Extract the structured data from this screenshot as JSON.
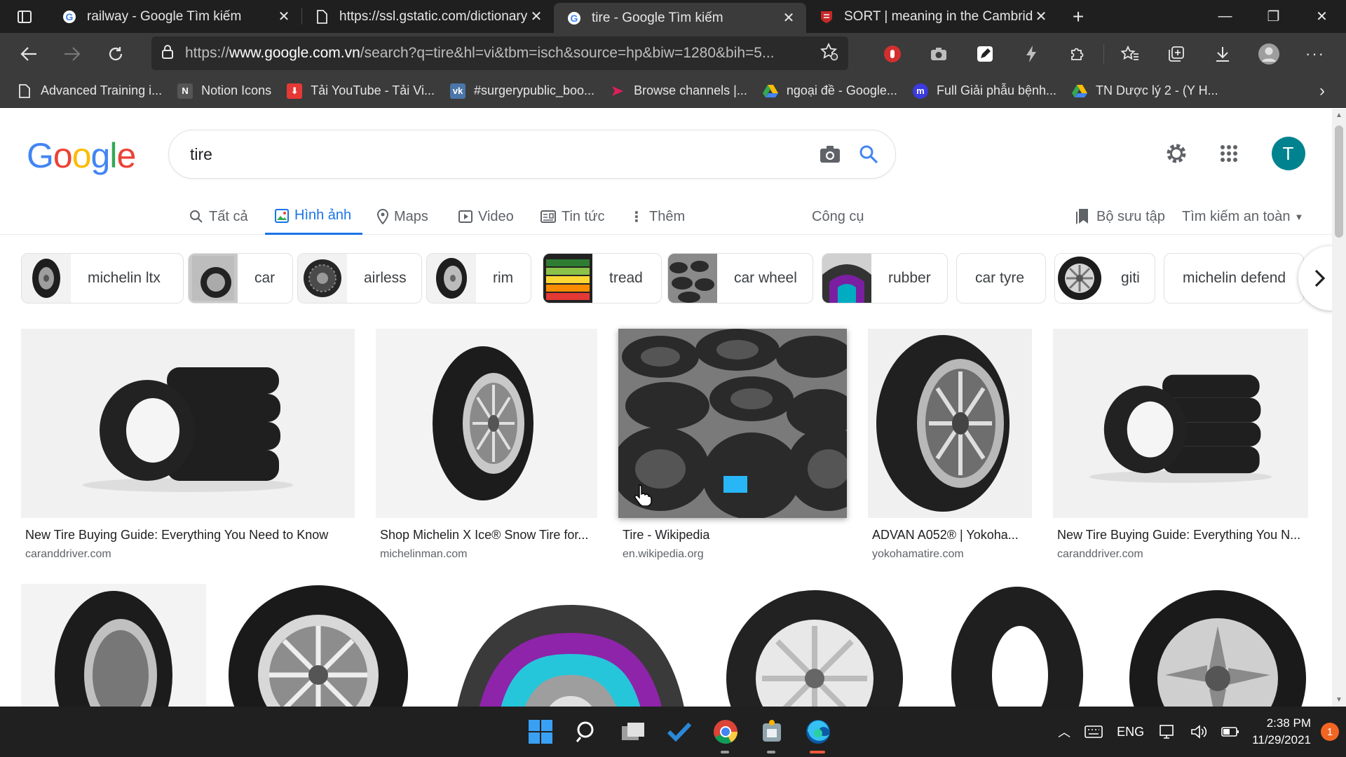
{
  "browser": {
    "tabs": [
      {
        "title": "railway - Google Tìm kiếm",
        "icon": "google-icon",
        "active": false
      },
      {
        "title": "https://ssl.gstatic.com/dictionary",
        "icon": "document-icon",
        "active": false
      },
      {
        "title": "tire - Google Tìm kiếm",
        "icon": "google-icon",
        "active": true
      },
      {
        "title": "SORT | meaning in the Cambridge",
        "icon": "cambridge-icon",
        "active": false
      }
    ],
    "url_prefix": "https://",
    "url_host": "www.google.com.vn",
    "url_path": "/search?q=tire&hl=vi&tbm=isch&source=hp&biw=1280&bih=5...",
    "bookmarks": [
      {
        "label": "Advanced Training i...",
        "icon": "page-icon",
        "color": "#e6e6e6"
      },
      {
        "label": "Notion Icons",
        "icon": "notion-icon",
        "color": "#555555"
      },
      {
        "label": "Tải YouTube - Tải Vi...",
        "icon": "download-icon",
        "color": "#e53935"
      },
      {
        "label": "#surgerypublic_boo...",
        "icon": "vk-icon",
        "color": "#4a76a8"
      },
      {
        "label": "Browse channels |...",
        "icon": "slack-icon",
        "color": "#e01e5a"
      },
      {
        "label": "ngoại đề - Google...",
        "icon": "drive-icon",
        "color": "#34a853"
      },
      {
        "label": "Full Giải phẫu bệnh...",
        "icon": "messenger-icon",
        "color": "#3b3bdf"
      },
      {
        "label": "TN Dược lý 2 - (Y H...",
        "icon": "drive-icon",
        "color": "#fbbc04"
      }
    ]
  },
  "google": {
    "logo": "Google",
    "query": "tire",
    "avatar_letter": "T",
    "tabs": [
      {
        "label": "Tất cả",
        "icon": "search-icon"
      },
      {
        "label": "Hình ảnh",
        "icon": "image-icon"
      },
      {
        "label": "Maps",
        "icon": "map-pin-icon"
      },
      {
        "label": "Video",
        "icon": "video-icon"
      },
      {
        "label": "Tin tức",
        "icon": "news-icon"
      },
      {
        "label": "Thêm",
        "icon": "more-vert-icon"
      }
    ],
    "tools_label": "Công cụ",
    "collections_label": "Bộ sưu tập",
    "safesearch_label": "Tìm kiếm an toàn",
    "chips": [
      "michelin ltx",
      "car",
      "airless",
      "rim",
      "tread",
      "car wheel",
      "rubber",
      "car tyre",
      "giti",
      "michelin defend"
    ],
    "results": [
      {
        "title": "New Tire Buying Guide: Everything You Need to Know",
        "source": "caranddriver.com"
      },
      {
        "title": "Shop Michelin X Ice® Snow Tire for...",
        "source": "michelinman.com"
      },
      {
        "title": "Tire - Wikipedia",
        "source": "en.wikipedia.org"
      },
      {
        "title": "ADVAN A052® | Yokoha...",
        "source": "yokohamatire.com"
      },
      {
        "title": "New Tire Buying Guide: Everything You N...",
        "source": "caranddriver.com"
      }
    ]
  },
  "taskbar": {
    "language": "ENG",
    "time": "2:38 PM",
    "date": "11/29/2021",
    "notifications": "1"
  },
  "colors": {
    "google_blue": "#4285F4",
    "google_red": "#EA4335",
    "google_yellow": "#FBBC05",
    "google_green": "#34A853",
    "active_tab_blue": "#1a73e8",
    "avatar": "#00838f"
  }
}
